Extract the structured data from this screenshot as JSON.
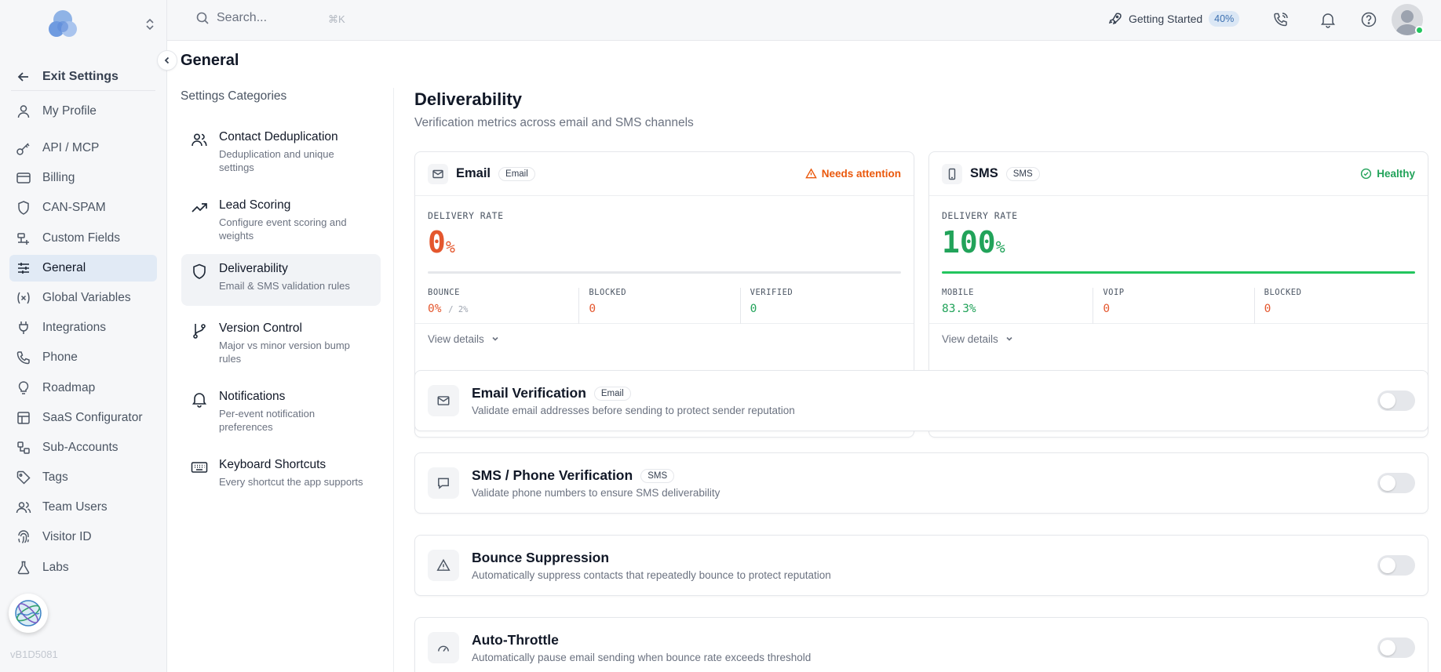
{
  "sidebar": {
    "exit_label": "Exit Settings",
    "items": [
      {
        "label": "My Profile",
        "icon": "user-icon"
      },
      {
        "label": "API / MCP",
        "icon": "key-icon"
      },
      {
        "label": "Billing",
        "icon": "credit-card-icon"
      },
      {
        "label": "CAN-SPAM",
        "icon": "shield-icon"
      },
      {
        "label": "Custom Fields",
        "icon": "fields-icon"
      },
      {
        "label": "General",
        "icon": "sliders-icon",
        "active": true
      },
      {
        "label": "Global Variables",
        "icon": "variable-icon"
      },
      {
        "label": "Integrations",
        "icon": "plug-icon"
      },
      {
        "label": "Phone",
        "icon": "phone-icon"
      },
      {
        "label": "Roadmap",
        "icon": "lightbulb-icon"
      },
      {
        "label": "SaaS Configurator",
        "icon": "layout-icon"
      },
      {
        "label": "Sub-Accounts",
        "icon": "sub-accounts-icon"
      },
      {
        "label": "Tags",
        "icon": "tag-icon"
      },
      {
        "label": "Team Users",
        "icon": "users-icon"
      },
      {
        "label": "Visitor ID",
        "icon": "fingerprint-icon"
      },
      {
        "label": "Labs",
        "icon": "flask-icon"
      }
    ],
    "version": "vB1D5081"
  },
  "topbar": {
    "search_placeholder": "Search...",
    "search_shortcut": "⌘K",
    "getting_started_label": "Getting Started",
    "getting_started_pct": "40%"
  },
  "page": {
    "title": "General",
    "categories_title": "Settings Categories",
    "categories": [
      {
        "name": "Contact Deduplication",
        "desc": "Deduplication and unique settings"
      },
      {
        "name": "Lead Scoring",
        "desc": "Configure event scoring and weights"
      },
      {
        "name": "Deliverability",
        "desc": "Email & SMS validation rules"
      },
      {
        "name": "Version Control",
        "desc": "Major vs minor version bump rules"
      },
      {
        "name": "Notifications",
        "desc": "Per-event notification preferences"
      },
      {
        "name": "Keyboard Shortcuts",
        "desc": "Every shortcut the app supports"
      }
    ]
  },
  "deliverability": {
    "title": "Deliverability",
    "subtitle": "Verification metrics across email and SMS channels",
    "email": {
      "title": "Email",
      "tag": "Email",
      "status": "Needs attention",
      "rate_label": "DELIVERY RATE",
      "rate_value": "0",
      "rate_unit": "%",
      "rate_fraction": 0,
      "bounce_label": "BOUNCE",
      "bounce_value": "0%",
      "bounce_of": "/ 2%",
      "blocked_label": "BLOCKED",
      "blocked_value": "0",
      "verified_label": "VERIFIED",
      "verified_value": "0",
      "details_label": "View details"
    },
    "sms": {
      "title": "SMS",
      "tag": "SMS",
      "status": "Healthy",
      "rate_label": "DELIVERY RATE",
      "rate_value": "100",
      "rate_unit": "%",
      "rate_fraction": 1,
      "mobile_label": "MOBILE",
      "mobile_value": "83.3%",
      "voip_label": "VOIP",
      "voip_value": "0",
      "blocked_label": "BLOCKED",
      "blocked_value": "0",
      "details_label": "View details"
    },
    "features": [
      {
        "title": "Email Verification",
        "tag": "Email",
        "desc": "Validate email addresses before sending to protect sender reputation",
        "enabled": false
      },
      {
        "title": "SMS / Phone Verification",
        "tag": "SMS",
        "desc": "Validate phone numbers to ensure SMS deliverability",
        "enabled": false
      },
      {
        "title": "Bounce Suppression",
        "tag": "",
        "desc": "Automatically suppress contacts that repeatedly bounce to protect reputation",
        "enabled": false
      },
      {
        "title": "Auto-Throttle",
        "tag": "",
        "desc": "Automatically pause email sending when bounce rate exceeds threshold",
        "enabled": false
      }
    ]
  }
}
